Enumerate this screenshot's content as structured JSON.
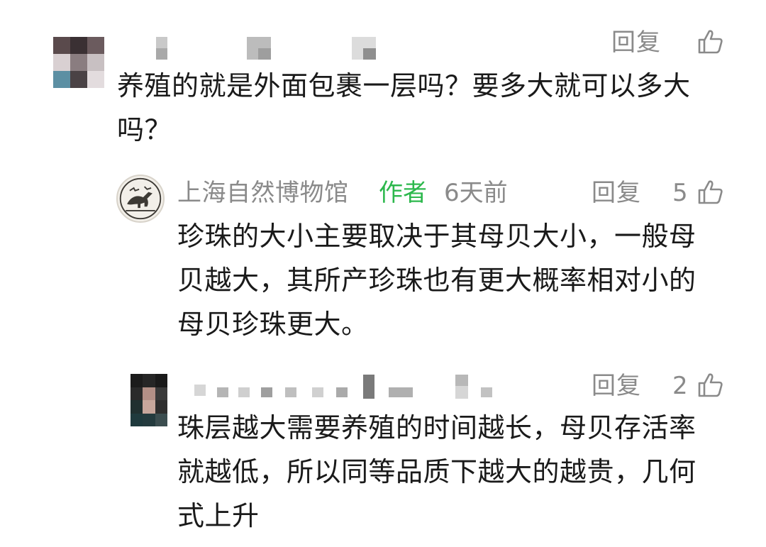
{
  "comments": [
    {
      "reply_label": "回复",
      "text": "养殖的就是外面包裹一层吗？要多大就可以多大吗？"
    },
    {
      "author": "上海自然博物馆",
      "author_tag": "作者",
      "time": "6天前",
      "reply_label": "回复",
      "likes": "5",
      "text": "珍珠的大小主要取决于其母贝大小，一般母贝越大，其所产珍珠也有更大概率相对小的母贝珍珠更大。"
    },
    {
      "reply_label": "回复",
      "likes": "2",
      "text": "珠层越大需要养殖的时间越长，母贝存活率就越低，所以同等品质下越大的越贵，几何式上升"
    }
  ],
  "colors": {
    "author_tag": "#2db84d",
    "meta_text": "#8a8a8a",
    "body_text": "#1a1a1a"
  },
  "icons": [
    "thumbs-up-icon",
    "museum-logo-avatar"
  ]
}
